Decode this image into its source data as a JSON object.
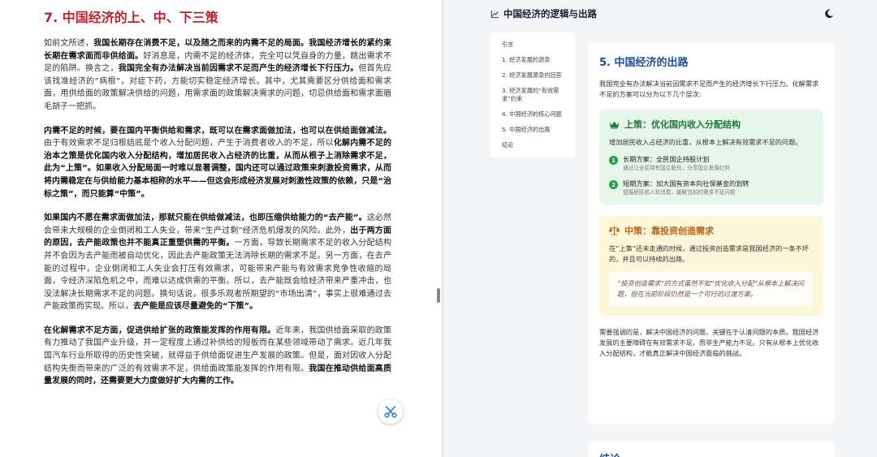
{
  "left": {
    "title": "7.  中国经济的上、中、下三策",
    "paragraphs": [
      [
        {
          "t": "如前文所述，",
          "b": false
        },
        {
          "t": "我国长期存在消费不足，以及随之而来的内需不足的局面。我国经济增长的紧约束长期在需求面而非供给面。",
          "b": true
        },
        {
          "t": "好消息是，内需不足的经济体，完全可以凭自身的力量，跳出需求不足的陷阱。换言之，",
          "b": false
        },
        {
          "t": "我国完全有办法解决当前因需求不足而产生的经济增长下行压力。",
          "b": true
        },
        {
          "t": "但首先应该找准经济的“病根”，对症下药，方能切实稳定经济增长。其中，尤其需要区分供给面和需求面，用供给面的政策解决供给的问题，用需求面的政策解决需求的问题，切忌供给面和需求面眉毛胡子一把抓。",
          "b": false
        }
      ],
      [
        {
          "t": "内需不足的时候，要在国内平衡供给和需求，既可以在需求面做加法，也可以在供给面做减法。",
          "b": true
        },
        {
          "t": "由于有效需求不足归根结底是个收入分配问题，产生于消费者收入的不足，所以",
          "b": false
        },
        {
          "t": "化解内需不足的治本之策是优化国内收入分配结构，增加居民收入占经济的比重，从而从根子上消除需求不足，此为“上策”。如果收入分配局面一时难以显著调整，国内还可以通过政策来刺激投资需求，从而将内需稳定在与供给能力基本相称的水平——但这会形成经济发展对刺激性政策的依赖，只是“治标之策”，而只能算“中策”。",
          "b": true
        }
      ],
      [
        {
          "t": "如果国内不愿在需求面做加法，那就只能在供给做减法，也即压缩供给能力的“去产能”。",
          "b": true
        },
        {
          "t": "这必然会带来大规模的企业倒闭和工人失业，带来“生产过剩”经济危机爆发的风险。此外，",
          "b": false
        },
        {
          "t": "出于两方面的原因，去产能政策也并不能真正重塑供需的平衡。",
          "b": true
        },
        {
          "t": "一方面，导致长期需求不足的收入分配结构并不会因为去产能而被自动优化，因此去产能政策无法消除长期的需求不足。另一方面，在去产能的过程中，企业倒闭和工人失业会打压有效需求，可能带来产能与有效需求竞争性收缩的局面，令经济深陷危机之中，而难以达成供需的平衡。所以，去产能既会给经济带来严重冲击，也没法解决长期需求不足的问题。换句话说，很多乐观者所期望的“市场出清”，事实上很难通过去产能政策而实现。所以，",
          "b": false
        },
        {
          "t": "去产能是应该尽量避免的“下策”。",
          "b": true
        }
      ],
      [
        {
          "t": "在化解需求不足方面，促进供给扩张的政策能发挥的作用有限。",
          "b": true
        },
        {
          "t": "近年来，我国供给面采取的政策有力推动了我国产业升级，并一定程度上通过补供给的短板而在某些领域带动了需求。近几年我国汽车行业所取得的历史性突破，就得益于供给面促进生产发展的政策。但是，面对因收入分配结构失衡而带来的广泛的有效需求不足，供给面政策能发挥的作用有限。",
          "b": false
        },
        {
          "t": "我国在推动供给面高质量发展的同时，还需要更大力度做好扩大内需的工作。",
          "b": true
        }
      ]
    ]
  },
  "right": {
    "app_title": "中国经济的逻辑与出路",
    "icons": {
      "chart": "line-chart-icon",
      "theme": "moon-icon",
      "crown": "crown-icon",
      "scale": "scale-icon",
      "tool": "scissors-icon"
    },
    "colors": {
      "title_red": "#b8242a",
      "section_blue": "#1b4f9c",
      "green": "#1e7a35",
      "amber": "#b5651d"
    },
    "toc": [
      "引言",
      "1. 经济发展的源泉",
      "2. 经济发展源泉的回答",
      "3. 经济发展的“有效需求”约束",
      "4. 中国经济的核心问题",
      "5. 中国经济的出路",
      "结论"
    ],
    "section": {
      "title": "5. 中国经济的出路",
      "intro": "我国完全有办法解决当前因需求不足而产生的经济增长下行压力。化解需求不足的方案可以分为以下几个层次:",
      "upper": {
        "title": "上策：优化国内收入分配结构",
        "desc": "增加居民收入占经济的比重，从根本上解决有效需求不足的问题。",
        "plans": [
          {
            "num": "1",
            "main": "长期方案：全民国企持股计划",
            "sub": "通过让全民持有国企股份，分享国企发展红利"
          },
          {
            "num": "2",
            "main": "短期方案：加大国有资本向社保基金的划转",
            "sub": "提振居民收入和消费，缓解当前的需求不足问题"
          }
        ]
      },
      "middle": {
        "title": "中策：靠投资创造需求",
        "desc": "在“上策”还未走通的时候，通过投资创造需求是我国经济的一条不坏的，并且可以持续的出路。",
        "quote": "“投资创造需求”的方式虽然不如“优化收入分配”从根本上解决问题，但在当前阶段仍然是一个可行的过渡方案。"
      },
      "closing": "需要强调的是，解决中国经济的问题，关键在于认清问题的本质。我国经济发展的主要障碍在有效需求不足，而非生产能力不足。只有从根本上优化收入分配结构，才能真正解决中国经济面临的挑战。"
    },
    "next_title": "结论"
  }
}
